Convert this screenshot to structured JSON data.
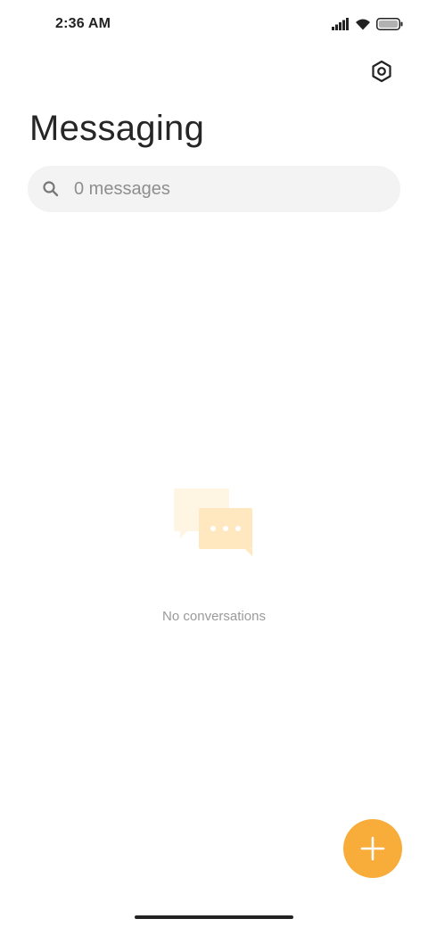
{
  "status_bar": {
    "time": "2:36 AM",
    "icons": [
      "signal-icon",
      "wifi-icon",
      "battery-icon"
    ]
  },
  "header": {
    "settings_icon": "settings-icon",
    "title": "Messaging"
  },
  "search": {
    "icon": "search-icon",
    "placeholder": "0 messages"
  },
  "empty_state": {
    "illustration": "chat-bubbles-icon",
    "message": "No conversations"
  },
  "fab": {
    "icon": "plus-icon",
    "color": "#f8ac3a"
  },
  "colors": {
    "accent": "#f8ac3a",
    "illustration_light": "#fff4de",
    "illustration_mid": "#ffe9c2"
  }
}
